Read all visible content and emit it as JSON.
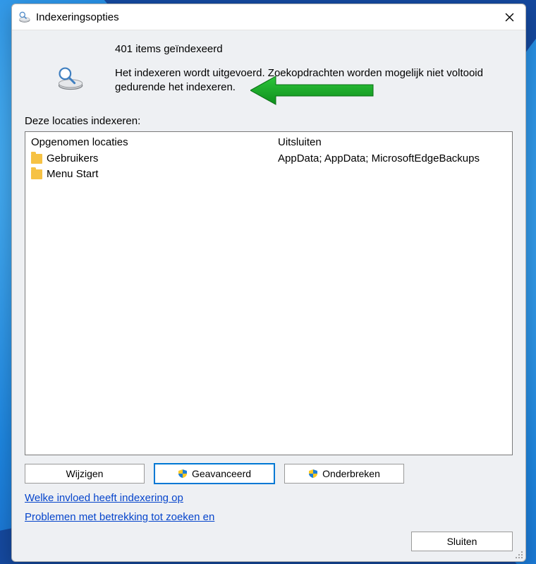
{
  "window": {
    "title": "Indexeringsopties"
  },
  "header": {
    "count_text": "401 items geïndexeerd",
    "status_text": "Het indexeren wordt uitgevoerd. Zoekopdrachten worden mogelijk niet voltooid gedurende het indexeren."
  },
  "locations": {
    "section_label": "Deze locaties indexeren:",
    "columns": {
      "included": "Opgenomen locaties",
      "excluded": "Uitsluiten"
    },
    "items": [
      {
        "name": "Gebruikers",
        "excluded": "AppData; AppData; MicrosoftEdgeBackups"
      },
      {
        "name": "Menu Start",
        "excluded": ""
      }
    ]
  },
  "buttons": {
    "modify": "Wijzigen",
    "advanced": "Geavanceerd",
    "pause": "Onderbreken",
    "close": "Sluiten"
  },
  "links": {
    "about": "Welke invloed heeft indexering op",
    "troubleshoot": "Problemen met betrekking tot zoeken en"
  },
  "colors": {
    "arrow": "#17a325"
  }
}
